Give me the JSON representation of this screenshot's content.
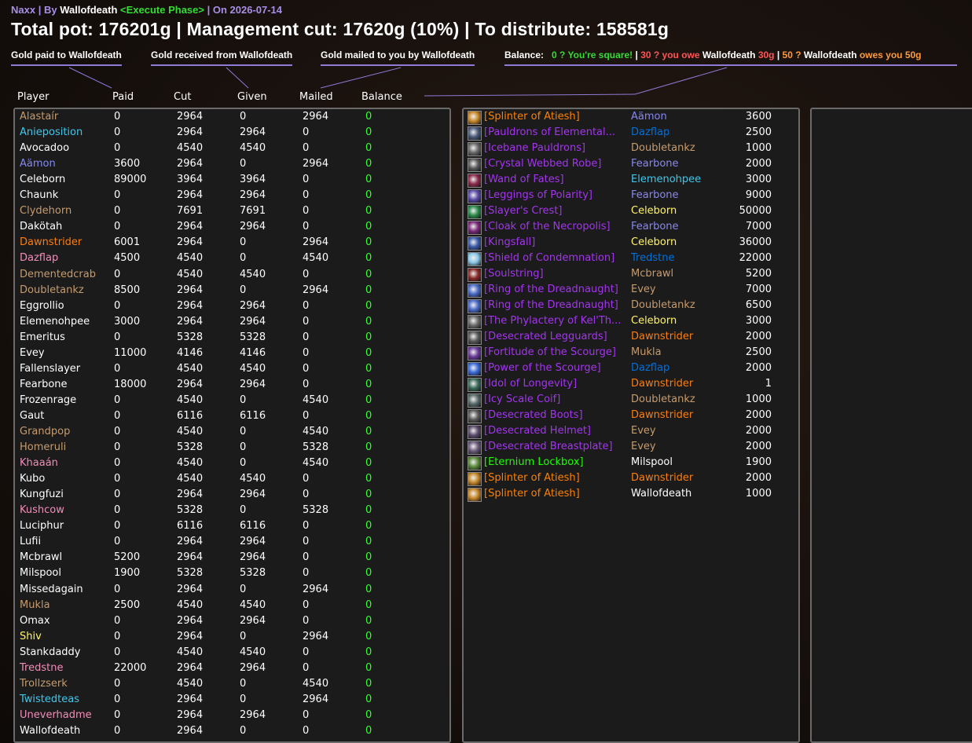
{
  "header": {
    "raid": "Naxx",
    "by_label": "By",
    "author": "Wallofdeath",
    "phase": "<Execute Phase>",
    "date_label": "On 2026-07-14",
    "summary": "Total pot: 176201g | Management cut: 17620g (10%) | To distribute: 158581g"
  },
  "legend": {
    "paid": "Gold paid to Wallofdeath",
    "received": "Gold received from Wallofdeath",
    "mailed": "Gold mailed to you by Wallofdeath",
    "balance_label": "Balance:",
    "square": "0 ? You're square!",
    "sep": "|",
    "owe_prefix": "30 ? you owe",
    "owe_name": "Wallofdeath",
    "owe_amount": "30g",
    "owes_prefix": "50 ?",
    "owes_name": "Wallofdeath",
    "owes_suffix": "owes you 50g"
  },
  "columns": [
    "Player",
    "Paid",
    "Cut",
    "Given",
    "Mailed",
    "Balance"
  ],
  "colors": {
    "druid": "#ff7c0a",
    "warrior": "#c69b6d",
    "rogue": "#fff468",
    "mage": "#3fc7eb",
    "priest": "#ffffff",
    "warlock": "#8788ee",
    "paladin": "#f48cba",
    "hunter": "#aad372",
    "shaman": "#0070dd",
    "epic": "#a335ee",
    "legendary": "#ff8000",
    "uncommon": "#1eff00",
    "balance_zero": "#33ff33"
  },
  "players": [
    {
      "name": "Alastaír",
      "cls": "warrior",
      "paid": "0",
      "cut": "2964",
      "given": "0",
      "mailed": "2964",
      "balance": "0"
    },
    {
      "name": "Anieposition",
      "cls": "mage",
      "paid": "0",
      "cut": "2964",
      "given": "2964",
      "mailed": "0",
      "balance": "0"
    },
    {
      "name": "Avocadoo",
      "cls": "priest",
      "paid": "0",
      "cut": "4540",
      "given": "4540",
      "mailed": "0",
      "balance": "0"
    },
    {
      "name": "Aämon",
      "cls": "warlock",
      "paid": "3600",
      "cut": "2964",
      "given": "0",
      "mailed": "2964",
      "balance": "0"
    },
    {
      "name": "Celeborn",
      "cls": "priest",
      "paid": "89000",
      "cut": "3964",
      "given": "3964",
      "mailed": "0",
      "balance": "0"
    },
    {
      "name": "Chaunk",
      "cls": "priest",
      "paid": "0",
      "cut": "2964",
      "given": "2964",
      "mailed": "0",
      "balance": "0"
    },
    {
      "name": "Clydehorn",
      "cls": "warrior",
      "paid": "0",
      "cut": "7691",
      "given": "7691",
      "mailed": "0",
      "balance": "0"
    },
    {
      "name": "Dakötah",
      "cls": "priest",
      "paid": "0",
      "cut": "2964",
      "given": "2964",
      "mailed": "0",
      "balance": "0"
    },
    {
      "name": "Dawnstrider",
      "cls": "druid",
      "paid": "6001",
      "cut": "2964",
      "given": "0",
      "mailed": "2964",
      "balance": "0"
    },
    {
      "name": "Dazflap",
      "cls": "paladin",
      "paid": "4500",
      "cut": "4540",
      "given": "0",
      "mailed": "4540",
      "balance": "0"
    },
    {
      "name": "Dementedcrab",
      "cls": "warrior",
      "paid": "0",
      "cut": "4540",
      "given": "4540",
      "mailed": "0",
      "balance": "0"
    },
    {
      "name": "Doubletankz",
      "cls": "warrior",
      "paid": "8500",
      "cut": "2964",
      "given": "0",
      "mailed": "2964",
      "balance": "0"
    },
    {
      "name": "Eggrollio",
      "cls": "priest",
      "paid": "0",
      "cut": "2964",
      "given": "2964",
      "mailed": "0",
      "balance": "0"
    },
    {
      "name": "Elemenohpee",
      "cls": "priest",
      "paid": "3000",
      "cut": "2964",
      "given": "2964",
      "mailed": "0",
      "balance": "0"
    },
    {
      "name": "Emeritus",
      "cls": "priest",
      "paid": "0",
      "cut": "5328",
      "given": "5328",
      "mailed": "0",
      "balance": "0"
    },
    {
      "name": "Evey",
      "cls": "priest",
      "paid": "11000",
      "cut": "4146",
      "given": "4146",
      "mailed": "0",
      "balance": "0"
    },
    {
      "name": "Fallenslayer",
      "cls": "priest",
      "paid": "0",
      "cut": "4540",
      "given": "4540",
      "mailed": "0",
      "balance": "0"
    },
    {
      "name": "Fearbone",
      "cls": "priest",
      "paid": "18000",
      "cut": "2964",
      "given": "2964",
      "mailed": "0",
      "balance": "0"
    },
    {
      "name": "Frozenrage",
      "cls": "priest",
      "paid": "0",
      "cut": "4540",
      "given": "0",
      "mailed": "4540",
      "balance": "0"
    },
    {
      "name": "Gaut",
      "cls": "priest",
      "paid": "0",
      "cut": "6116",
      "given": "6116",
      "mailed": "0",
      "balance": "0"
    },
    {
      "name": "Grandpop",
      "cls": "warrior",
      "paid": "0",
      "cut": "4540",
      "given": "0",
      "mailed": "4540",
      "balance": "0"
    },
    {
      "name": "Homeruli",
      "cls": "warrior",
      "paid": "0",
      "cut": "5328",
      "given": "0",
      "mailed": "5328",
      "balance": "0"
    },
    {
      "name": "Khaaán",
      "cls": "paladin",
      "paid": "0",
      "cut": "4540",
      "given": "0",
      "mailed": "4540",
      "balance": "0"
    },
    {
      "name": "Kubo",
      "cls": "priest",
      "paid": "0",
      "cut": "4540",
      "given": "4540",
      "mailed": "0",
      "balance": "0"
    },
    {
      "name": "Kungfuzi",
      "cls": "priest",
      "paid": "0",
      "cut": "2964",
      "given": "2964",
      "mailed": "0",
      "balance": "0"
    },
    {
      "name": "Kushcow",
      "cls": "paladin",
      "paid": "0",
      "cut": "5328",
      "given": "0",
      "mailed": "5328",
      "balance": "0"
    },
    {
      "name": "Luciphur",
      "cls": "priest",
      "paid": "0",
      "cut": "6116",
      "given": "6116",
      "mailed": "0",
      "balance": "0"
    },
    {
      "name": "Lufii",
      "cls": "priest",
      "paid": "0",
      "cut": "2964",
      "given": "2964",
      "mailed": "0",
      "balance": "0"
    },
    {
      "name": "Mcbrawl",
      "cls": "priest",
      "paid": "5200",
      "cut": "2964",
      "given": "2964",
      "mailed": "0",
      "balance": "0"
    },
    {
      "name": "Milspool",
      "cls": "priest",
      "paid": "1900",
      "cut": "5328",
      "given": "5328",
      "mailed": "0",
      "balance": "0"
    },
    {
      "name": "Missedagain",
      "cls": "priest",
      "paid": "0",
      "cut": "2964",
      "given": "0",
      "mailed": "2964",
      "balance": "0"
    },
    {
      "name": "Mukla",
      "cls": "warrior",
      "paid": "2500",
      "cut": "4540",
      "given": "4540",
      "mailed": "0",
      "balance": "0"
    },
    {
      "name": "Omax",
      "cls": "priest",
      "paid": "0",
      "cut": "2964",
      "given": "2964",
      "mailed": "0",
      "balance": "0"
    },
    {
      "name": "Shiv",
      "cls": "rogue",
      "paid": "0",
      "cut": "2964",
      "given": "0",
      "mailed": "2964",
      "balance": "0"
    },
    {
      "name": "Stankdaddy",
      "cls": "priest",
      "paid": "0",
      "cut": "4540",
      "given": "4540",
      "mailed": "0",
      "balance": "0"
    },
    {
      "name": "Tredstne",
      "cls": "paladin",
      "paid": "22000",
      "cut": "2964",
      "given": "2964",
      "mailed": "0",
      "balance": "0"
    },
    {
      "name": "Trollzserk",
      "cls": "warrior",
      "paid": "0",
      "cut": "4540",
      "given": "0",
      "mailed": "4540",
      "balance": "0"
    },
    {
      "name": "Twistedteas",
      "cls": "mage",
      "paid": "0",
      "cut": "2964",
      "given": "0",
      "mailed": "2964",
      "balance": "0"
    },
    {
      "name": "Uneverhadme",
      "cls": "paladin",
      "paid": "0",
      "cut": "2964",
      "given": "2964",
      "mailed": "0",
      "balance": "0"
    },
    {
      "name": "Wallofdeath",
      "cls": "priest",
      "paid": "0",
      "cut": "2964",
      "given": "0",
      "mailed": "0",
      "balance": "0"
    }
  ],
  "loot": [
    {
      "item": "[Splinter of Atiesh]",
      "quality": "legendary",
      "icon": "orange-shard-icon",
      "icon_color": "#c8882a",
      "winner": "Aämon",
      "cls": "warlock",
      "price": "3600"
    },
    {
      "item": "[Pauldrons of Elemental...",
      "quality": "epic",
      "icon": "shoulder-armor-icon",
      "icon_color": "#4a5a7a",
      "winner": "Dazflap",
      "cls": "shaman",
      "price": "2500"
    },
    {
      "item": "[Icebane Pauldrons]",
      "quality": "epic",
      "icon": "shoulder-armor-icon",
      "icon_color": "#6a6a6a",
      "winner": "Doubletankz",
      "cls": "warrior",
      "price": "1000"
    },
    {
      "item": "[Crystal Webbed Robe]",
      "quality": "epic",
      "icon": "robe-icon",
      "icon_color": "#5a5a5a",
      "winner": "Fearbone",
      "cls": "warlock",
      "price": "2000"
    },
    {
      "item": "[Wand of Fates]",
      "quality": "epic",
      "icon": "wand-icon",
      "icon_color": "#8a2a4a",
      "winner": "Elemenohpee",
      "cls": "mage",
      "price": "3000"
    },
    {
      "item": "[Leggings of Polarity]",
      "quality": "epic",
      "icon": "leggings-icon",
      "icon_color": "#5a4aa8",
      "winner": "Fearbone",
      "cls": "warlock",
      "price": "9000"
    },
    {
      "item": "[Slayer's Crest]",
      "quality": "epic",
      "icon": "trinket-icon",
      "icon_color": "#2a8a4a",
      "winner": "Celeborn",
      "cls": "rogue",
      "price": "50000"
    },
    {
      "item": "[Cloak of the Necropolis]",
      "quality": "epic",
      "icon": "cloak-icon",
      "icon_color": "#7a2a7a",
      "winner": "Fearbone",
      "cls": "warlock",
      "price": "7000"
    },
    {
      "item": "[Kingsfall]",
      "quality": "epic",
      "icon": "dagger-icon",
      "icon_color": "#3a5aa8",
      "winner": "Celeborn",
      "cls": "rogue",
      "price": "36000"
    },
    {
      "item": "[Shield of Condemnation]",
      "quality": "epic",
      "icon": "shield-icon",
      "icon_color": "#8ac8e8",
      "winner": "Tredstne",
      "cls": "shaman",
      "price": "22000"
    },
    {
      "item": "[Soulstring]",
      "quality": "epic",
      "icon": "bow-icon",
      "icon_color": "#8a2a2a",
      "winner": "Mcbrawl",
      "cls": "warrior",
      "price": "5200"
    },
    {
      "item": "[Ring of the Dreadnaught]",
      "quality": "epic",
      "icon": "ring-icon",
      "icon_color": "#4a6ac8",
      "winner": "Evey",
      "cls": "warrior",
      "price": "7000"
    },
    {
      "item": "[Ring of the Dreadnaught]",
      "quality": "epic",
      "icon": "ring-icon",
      "icon_color": "#4a6ac8",
      "winner": "Doubletankz",
      "cls": "warrior",
      "price": "6500"
    },
    {
      "item": "[The Phylactery of Kel'Th...",
      "quality": "epic",
      "icon": "phylactery-icon",
      "icon_color": "#6a6a6a",
      "winner": "Celeborn",
      "cls": "rogue",
      "price": "3000"
    },
    {
      "item": "[Desecrated Legguards]",
      "quality": "epic",
      "icon": "leggings-icon",
      "icon_color": "#5a5a5a",
      "winner": "Dawnstrider",
      "cls": "druid",
      "price": "2000"
    },
    {
      "item": "[Fortitude of the Scourge]",
      "quality": "epic",
      "icon": "scroll-icon",
      "icon_color": "#6a3a9a",
      "winner": "Mukla",
      "cls": "warrior",
      "price": "2500"
    },
    {
      "item": "[Power of the Scourge]",
      "quality": "epic",
      "icon": "scroll-icon",
      "icon_color": "#3a6ad8",
      "winner": "Dazflap",
      "cls": "shaman",
      "price": "2000"
    },
    {
      "item": "[Idol of Longevity]",
      "quality": "epic",
      "icon": "idol-icon",
      "icon_color": "#3a6a5a",
      "winner": "Dawnstrider",
      "cls": "druid",
      "price": "1"
    },
    {
      "item": "[Icy Scale Coif]",
      "quality": "epic",
      "icon": "helmet-icon",
      "icon_color": "#5a6a6a",
      "winner": "Doubletankz",
      "cls": "warrior",
      "price": "1000"
    },
    {
      "item": "[Desecrated Boots]",
      "quality": "epic",
      "icon": "boots-icon",
      "icon_color": "#5a5a5a",
      "winner": "Dawnstrider",
      "cls": "druid",
      "price": "2000"
    },
    {
      "item": "[Desecrated Helmet]",
      "quality": "epic",
      "icon": "helmet-icon",
      "icon_color": "#5a4a6a",
      "winner": "Evey",
      "cls": "warrior",
      "price": "2000"
    },
    {
      "item": "[Desecrated Breastplate]",
      "quality": "epic",
      "icon": "chest-armor-icon",
      "icon_color": "#6a5a7a",
      "winner": "Evey",
      "cls": "warrior",
      "price": "2000"
    },
    {
      "item": "[Eternium Lockbox]",
      "quality": "uncommon",
      "icon": "lockbox-icon",
      "icon_color": "#5a8a3a",
      "winner": "Milspool",
      "cls": "priest",
      "price": "1900"
    },
    {
      "item": "[Splinter of Atiesh]",
      "quality": "legendary",
      "icon": "orange-shard-icon",
      "icon_color": "#c8882a",
      "winner": "Dawnstrider",
      "cls": "druid",
      "price": "2000"
    },
    {
      "item": "[Splinter of Atiesh]",
      "quality": "legendary",
      "icon": "orange-shard-icon",
      "icon_color": "#c8882a",
      "winner": "Wallofdeath",
      "cls": "priest",
      "price": "1000"
    }
  ]
}
